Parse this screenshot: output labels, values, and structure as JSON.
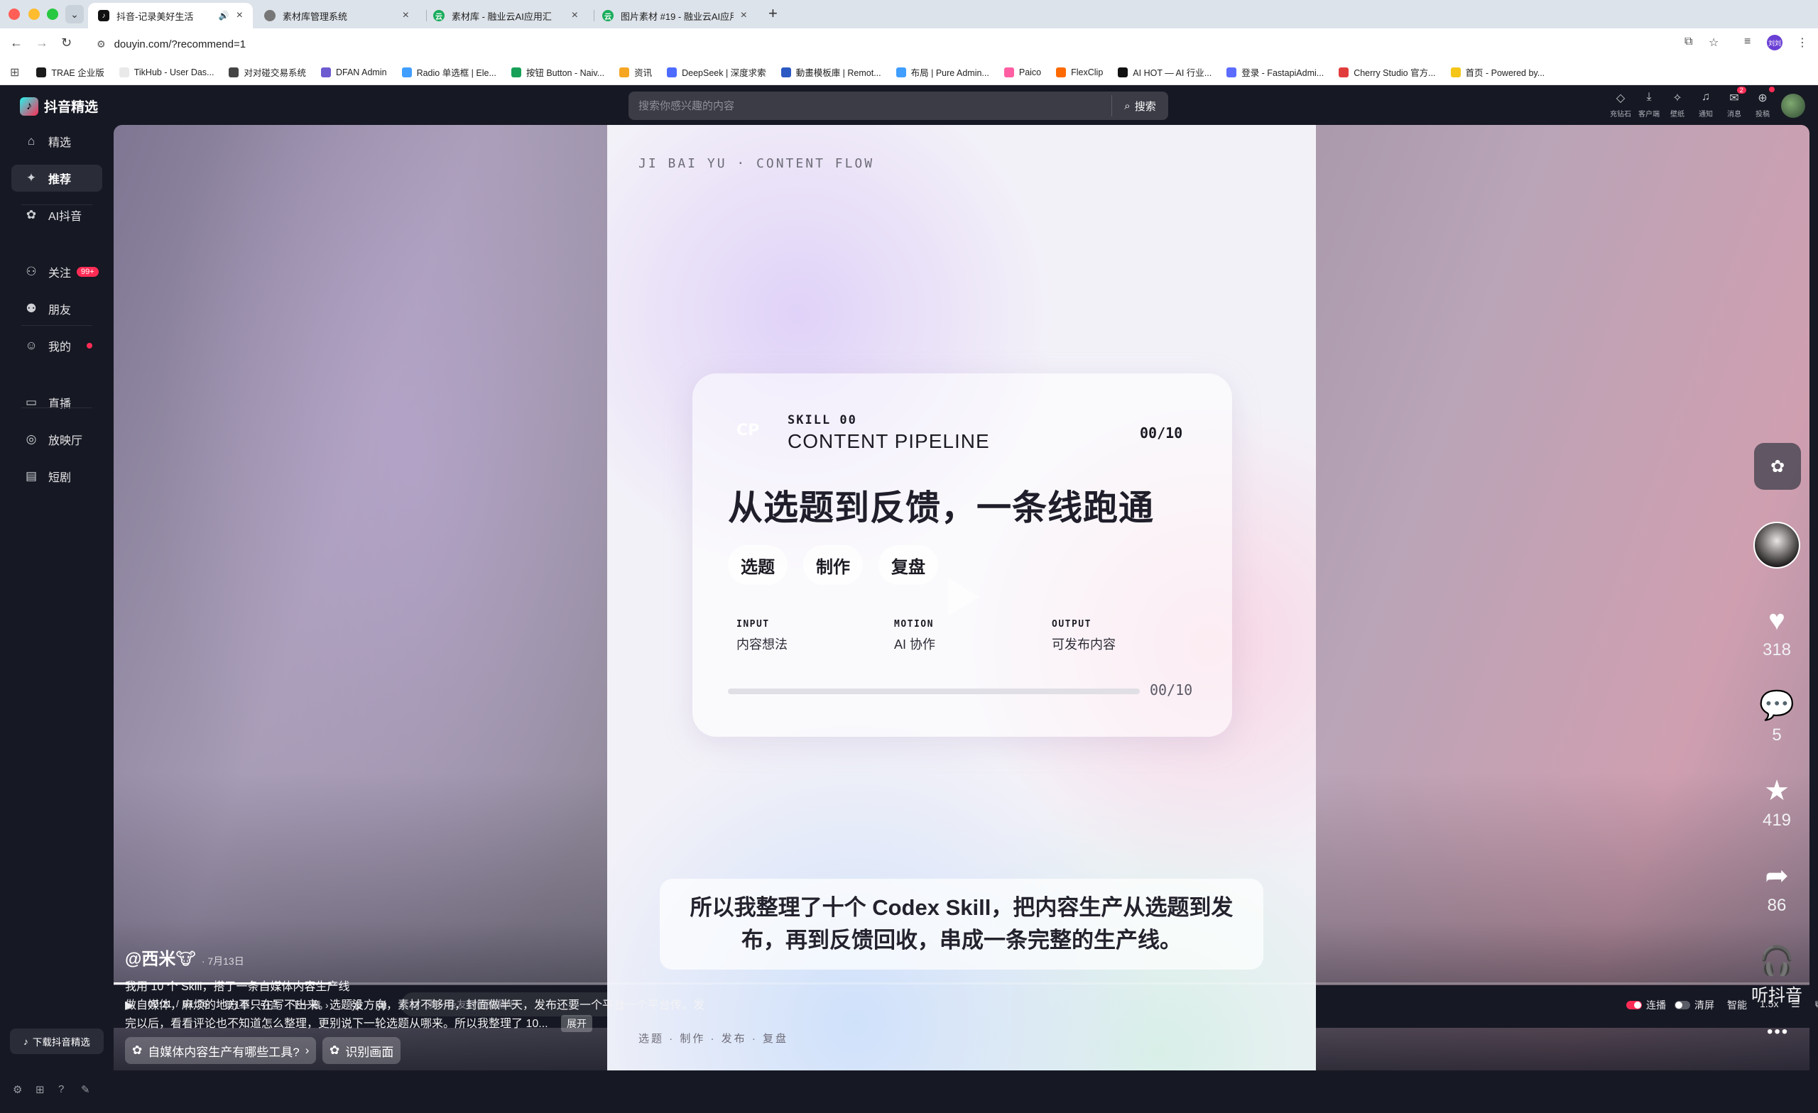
{
  "browser": {
    "tabs": [
      {
        "title": "抖音-记录美好生活",
        "active": true
      },
      {
        "title": "素材库管理系统",
        "active": false
      },
      {
        "title": "素材库 - 融业云AI应用汇",
        "active": false
      },
      {
        "title": "图片素材 #19 - 融业云AI应用汇",
        "active": false
      }
    ],
    "url": "douyin.com/?recommend=1",
    "profile_initials": "刘刘",
    "bookmarks": [
      {
        "label": "TRAE 企业版",
        "color": "#1b1b1b"
      },
      {
        "label": "TikHub - User Das...",
        "color": "#e9e9e9"
      },
      {
        "label": "对对碰交易系统",
        "color": "#444444"
      },
      {
        "label": "DFAN Admin",
        "color": "#6d5bd0"
      },
      {
        "label": "Radio 单选框 | Ele...",
        "color": "#409eff"
      },
      {
        "label": "按钮 Button - Naiv...",
        "color": "#18a058"
      },
      {
        "label": "资讯",
        "color": "#f5a623"
      },
      {
        "label": "DeepSeek | 深度求索",
        "color": "#4d6bfe"
      },
      {
        "label": "動畫模板庫 | Remot...",
        "color": "#2b59c3"
      },
      {
        "label": "布局 | Pure Admin...",
        "color": "#409eff"
      },
      {
        "label": "Paico",
        "color": "#ff5fa2"
      },
      {
        "label": "FlexClip",
        "color": "#ff6a00"
      },
      {
        "label": "AI HOT — AI 行业...",
        "color": "#111111"
      },
      {
        "label": "登录 - FastapiAdmi...",
        "color": "#5b6cff"
      },
      {
        "label": "Cherry Studio 官方...",
        "color": "#e23d3d"
      },
      {
        "label": "首页 - Powered by...",
        "color": "#f5c518"
      }
    ]
  },
  "app": {
    "brand": "抖音精选",
    "nav": [
      {
        "label": "精选",
        "icon": "home-icon"
      },
      {
        "label": "推荐",
        "icon": "sparkle-icon",
        "active": true
      },
      {
        "label": "AI抖音",
        "icon": "ai-flower-icon"
      },
      {
        "label": "关注",
        "icon": "follow-icon",
        "badge": "99+"
      },
      {
        "label": "朋友",
        "icon": "friends-icon"
      },
      {
        "label": "我的",
        "icon": "profile-icon",
        "dot": true
      },
      {
        "label": "直播",
        "icon": "live-icon"
      },
      {
        "label": "放映厅",
        "icon": "cinema-icon"
      },
      {
        "label": "短剧",
        "icon": "drama-icon"
      }
    ],
    "download_label": "下载抖音精选",
    "search": {
      "placeholder": "搜索你感兴趣的内容",
      "button": "搜索"
    },
    "top_actions": [
      {
        "label": "充钻石",
        "icon": "diamond-icon"
      },
      {
        "label": "客户端",
        "icon": "download-icon"
      },
      {
        "label": "壁纸",
        "icon": "wallpaper-icon"
      },
      {
        "label": "通知",
        "icon": "bell-icon"
      },
      {
        "label": "消息",
        "icon": "message-icon",
        "badge": "2"
      },
      {
        "label": "投稿",
        "icon": "upload-icon",
        "dot": true
      }
    ]
  },
  "video": {
    "watermark_title": "JI BAI YU · CONTENT FLOW",
    "card": {
      "logo": "CP",
      "skill_tag": "SKILL 00",
      "skill_name": "CONTENT PIPELINE",
      "counter": "00/10",
      "headline": "从选题到反馈，一条线跑通",
      "pills": [
        "选题",
        "制作",
        "复盘"
      ],
      "io": [
        {
          "label": "INPUT",
          "value": "内容想法"
        },
        {
          "label": "MOTION",
          "value": "AI 协作"
        },
        {
          "label": "OUTPUT",
          "value": "可发布内容"
        }
      ],
      "progress": 0,
      "progress_label": "00/10"
    },
    "subtitle": "所以我整理了十个 Codex Skill，把内容生产从选题到发布，再到反馈回收，串成一条完整的生产线。",
    "step_row": "选题 · 制作 · 发布 · 复盘"
  },
  "caption": {
    "author": "@西米🐮",
    "date": "· 7月13日",
    "title": "我用 10 个 Skill，搭了一条自媒体内容生产线",
    "body": "做自媒体，麻烦的地方不只在写不出来。选题没方向，素材不够用，封面做半天，发布还要一个平台一个平台传。发完以后，看看评论也不知道怎么整理，更别说下一轮选题从哪来。所以我整理了 10...",
    "expand": "展开",
    "chips": [
      "自媒体内容生产有哪些工具?",
      "识别画面"
    ]
  },
  "rail": {
    "likes": "318",
    "comments": "5",
    "favorites": "419",
    "shares": "86",
    "listen": "听抖音"
  },
  "controls": {
    "current": "00:11",
    "separator": "/",
    "duration": "01:26",
    "chapter": "第1章：引言",
    "next_chapter": "下一章",
    "danmu_placeholder": "发一条友好的弹幕吧",
    "send": "发送",
    "autoplay": "连播",
    "clear": "清屏",
    "smart": "智能",
    "speed": "1.5x",
    "progress": 0.128
  }
}
